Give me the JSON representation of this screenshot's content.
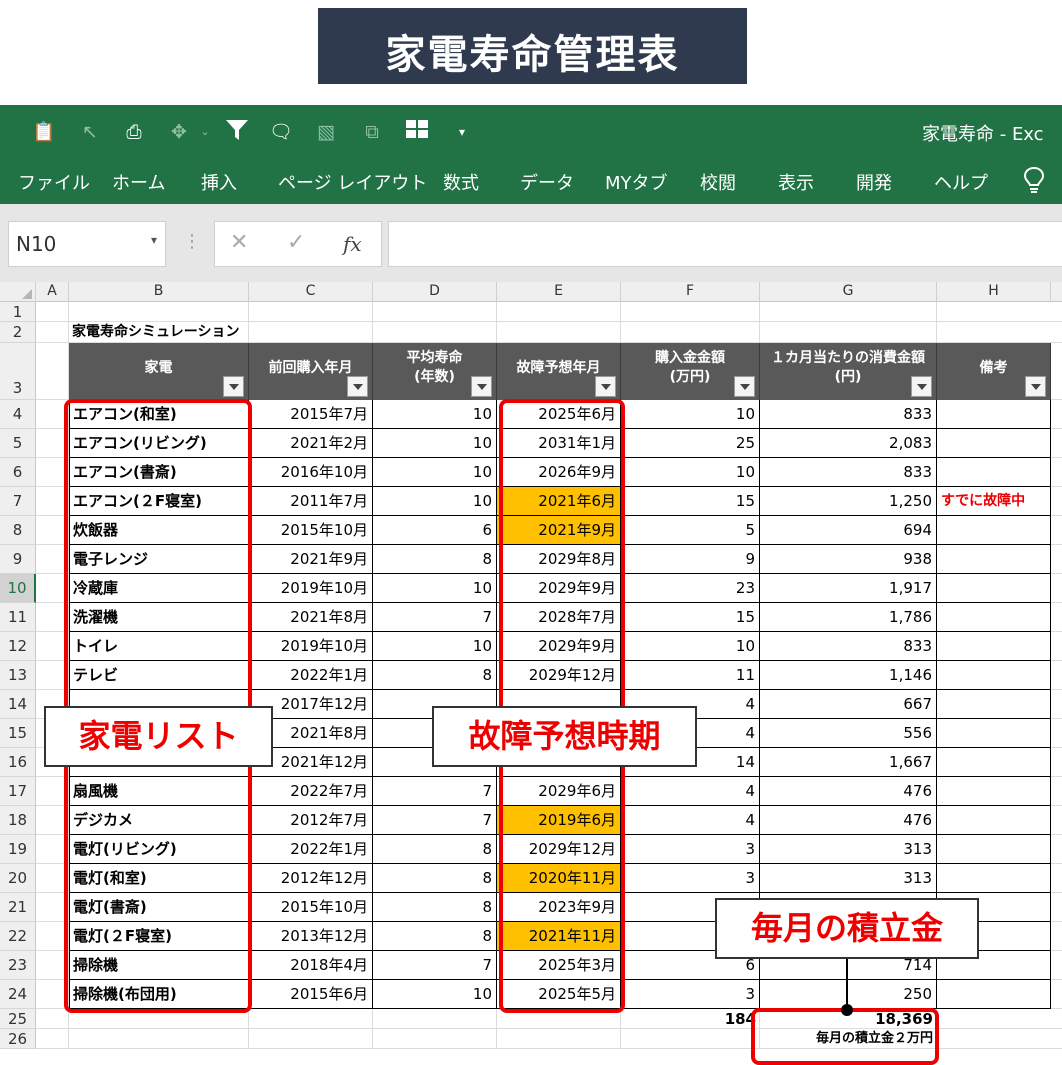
{
  "banner": {
    "title": "家電寿命管理表"
  },
  "window": {
    "title": "家電寿命 - Exc"
  },
  "ribbon": {
    "tabs": [
      "ファイル",
      "ホーム",
      "挿入",
      "ページ レイアウト",
      "数式",
      "データ",
      "MYタブ",
      "校閲",
      "表示",
      "開発",
      "ヘルプ"
    ]
  },
  "formula_bar": {
    "name_box": "N10",
    "fx": "fx",
    "cancel": "✕",
    "enter": "✓",
    "formula": ""
  },
  "columns": [
    "A",
    "B",
    "C",
    "D",
    "E",
    "F",
    "G",
    "H"
  ],
  "row_numbers": [
    "1",
    "2",
    "3",
    "4",
    "5",
    "6",
    "7",
    "8",
    "9",
    "10",
    "11",
    "12",
    "13",
    "14",
    "15",
    "16",
    "17",
    "18",
    "19",
    "20",
    "21",
    "22",
    "23",
    "24",
    "25",
    "26"
  ],
  "selected_row": "10",
  "sheet": {
    "caption": "家電寿命シミュレーション",
    "headers": [
      "家電",
      "前回購入年月",
      "平均寿命\n(年数)",
      "故障予想年月",
      "購入金金額\n(万円)",
      "１カ月当たりの消費金額\n(円)",
      "備考"
    ],
    "rows": [
      [
        "エアコン(和室)",
        "2015年7月",
        "10",
        "2025年6月",
        "10",
        "833",
        ""
      ],
      [
        "エアコン(リビング)",
        "2021年2月",
        "10",
        "2031年1月",
        "25",
        "2,083",
        ""
      ],
      [
        "エアコン(書斎)",
        "2016年10月",
        "10",
        "2026年9月",
        "10",
        "833",
        ""
      ],
      [
        "エアコン(２F寝室)",
        "2011年7月",
        "10",
        "2021年6月",
        "15",
        "1,250",
        "すでに故障中"
      ],
      [
        "炊飯器",
        "2015年10月",
        "6",
        "2021年9月",
        "5",
        "694",
        ""
      ],
      [
        "電子レンジ",
        "2021年9月",
        "8",
        "2029年8月",
        "9",
        "938",
        ""
      ],
      [
        "冷蔵庫",
        "2019年10月",
        "10",
        "2029年9月",
        "23",
        "1,917",
        ""
      ],
      [
        "洗濯機",
        "2021年8月",
        "7",
        "2028年7月",
        "15",
        "1,786",
        ""
      ],
      [
        "トイレ",
        "2019年10月",
        "10",
        "2029年9月",
        "10",
        "833",
        ""
      ],
      [
        "テレビ",
        "2022年1月",
        "8",
        "2029年12月",
        "11",
        "1,146",
        ""
      ],
      [
        "",
        "2017年12月",
        "",
        "",
        "4",
        "667",
        ""
      ],
      [
        "",
        "2021年8月",
        "",
        "",
        "4",
        "556",
        ""
      ],
      [
        "",
        "2021年12月",
        "",
        "",
        "14",
        "1,667",
        ""
      ],
      [
        "扇風機",
        "2022年7月",
        "7",
        "2029年6月",
        "4",
        "476",
        ""
      ],
      [
        "デジカメ",
        "2012年7月",
        "7",
        "2019年6月",
        "4",
        "476",
        ""
      ],
      [
        "電灯(リビング)",
        "2022年1月",
        "8",
        "2029年12月",
        "3",
        "313",
        ""
      ],
      [
        "電灯(和室)",
        "2012年12月",
        "8",
        "2020年11月",
        "3",
        "313",
        ""
      ],
      [
        "電灯(書斎)",
        "2015年10月",
        "8",
        "2023年9月",
        "",
        "",
        ""
      ],
      [
        "電灯(２F寝室)",
        "2013年12月",
        "8",
        "2021年11月",
        "",
        "",
        ""
      ],
      [
        "掃除機",
        "2018年4月",
        "7",
        "2025年3月",
        "6",
        "714",
        ""
      ],
      [
        "掃除機(布団用)",
        "2015年6月",
        "10",
        "2025年5月",
        "3",
        "250",
        ""
      ]
    ],
    "highlighted_rows": [
      3,
      4,
      14,
      16,
      18
    ],
    "highlight_color": "#ffc000",
    "header_color": "#595959",
    "note_color": "#ee0000",
    "total_price": "184",
    "total_monthly": "18,369",
    "savings_note": "毎月の積立金２万円"
  },
  "callouts": {
    "list": "家電リスト",
    "period": "故障予想時期",
    "savings": "毎月の積立金"
  },
  "accent": "#217346",
  "annotation_color": "#ee0000",
  "icons": [
    "clipboard-icon",
    "cursor-icon",
    "print-preview-icon",
    "pivot-icon",
    "filter-icon",
    "comment-icon",
    "shapes-icon",
    "clear-icon",
    "grid-icon",
    "customize-icon",
    "lightbulb-icon",
    "dropdown-icon"
  ]
}
